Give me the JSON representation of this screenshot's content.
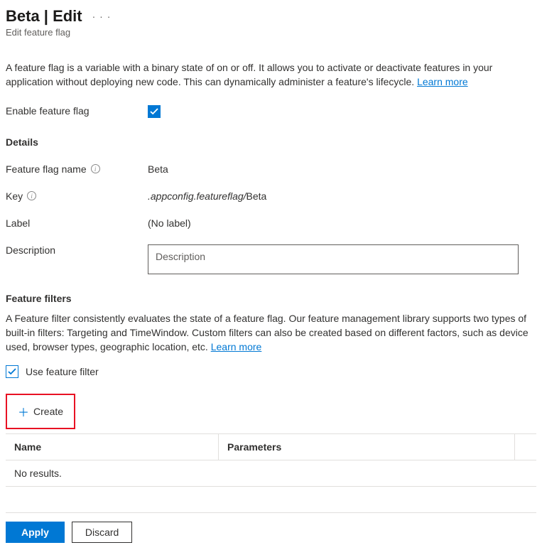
{
  "header": {
    "title": "Beta | Edit",
    "subtitle": "Edit feature flag"
  },
  "intro": {
    "text": "A feature flag is a variable with a binary state of on or off. It allows you to activate or deactivate features in your application without deploying new code. This can dynamically administer a feature's lifecycle. ",
    "learn_more": "Learn more"
  },
  "enable": {
    "label": "Enable feature flag",
    "checked": true
  },
  "details": {
    "section_title": "Details",
    "name_label": "Feature flag name",
    "name_value": "Beta",
    "key_label": "Key",
    "key_prefix": ".appconfig.featureflag/",
    "key_suffix": "Beta",
    "label_label": "Label",
    "label_value": "(No label)",
    "desc_label": "Description",
    "desc_placeholder": "Description",
    "desc_value": ""
  },
  "filters": {
    "section_title": "Feature filters",
    "text": "A Feature filter consistently evaluates the state of a feature flag. Our feature management library supports two types of built-in filters: Targeting and TimeWindow. Custom filters can also be created based on different factors, such as device used, browser types, geographic location, etc. ",
    "learn_more": "Learn more",
    "use_filter_label": "Use feature filter",
    "use_filter_checked": true,
    "create_label": "Create",
    "table": {
      "col_name": "Name",
      "col_params": "Parameters",
      "empty": "No results."
    }
  },
  "footer": {
    "apply": "Apply",
    "discard": "Discard"
  }
}
